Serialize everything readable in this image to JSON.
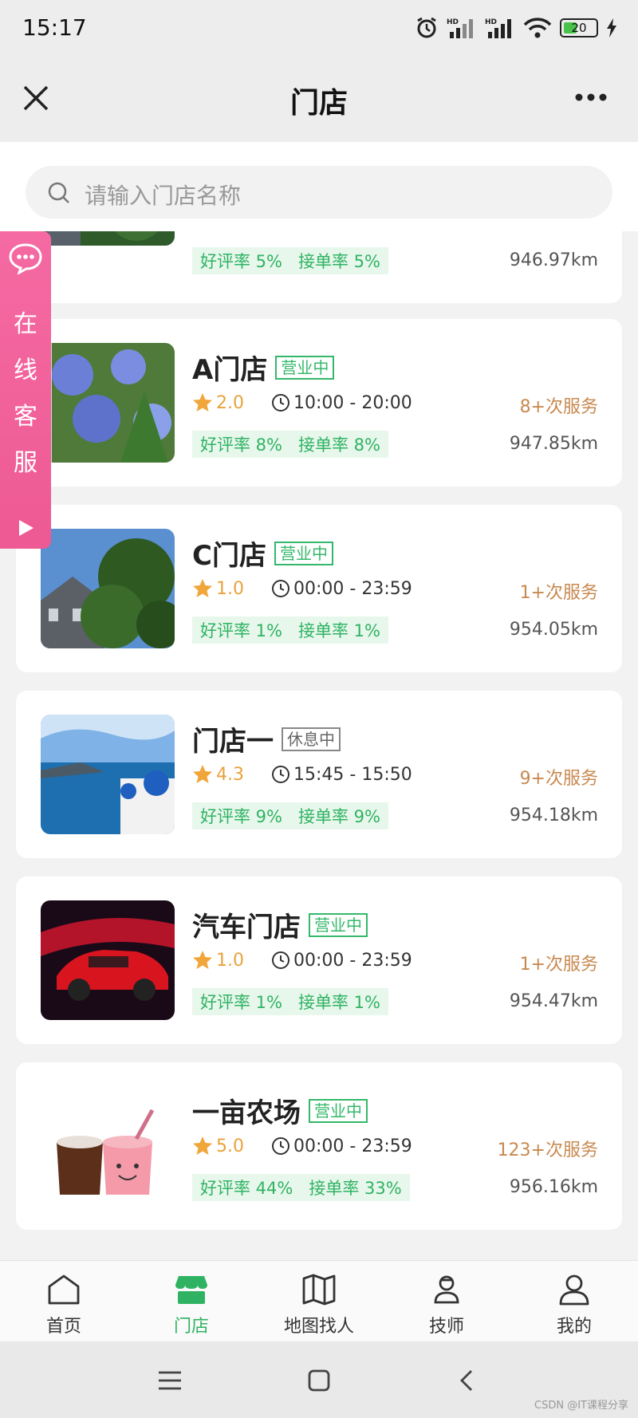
{
  "status_bar": {
    "time": "15:17",
    "battery": "20"
  },
  "header": {
    "title": "门店"
  },
  "search": {
    "placeholder": "请输入门店名称"
  },
  "float_service": {
    "chars": [
      "在",
      "线",
      "客",
      "服"
    ]
  },
  "stores": [
    {
      "name": "",
      "status": "",
      "rating": "",
      "hours": "",
      "service": "",
      "good_rate": "好评率 5%",
      "accept_rate": "接单率 5%",
      "distance": "946.97km"
    },
    {
      "name": "A门店",
      "status": "营业中",
      "rating": "2.0",
      "hours": "10:00 - 20:00",
      "service": "8+次服务",
      "good_rate": "好评率 8%",
      "accept_rate": "接单率 8%",
      "distance": "947.85km"
    },
    {
      "name": "C门店",
      "status": "营业中",
      "rating": "1.0",
      "hours": "00:00 - 23:59",
      "service": "1+次服务",
      "good_rate": "好评率 1%",
      "accept_rate": "接单率 1%",
      "distance": "954.05km"
    },
    {
      "name": "门店一",
      "status": "休息中",
      "rating": "4.3",
      "hours": "15:45 - 15:50",
      "service": "9+次服务",
      "good_rate": "好评率 9%",
      "accept_rate": "接单率 9%",
      "distance": "954.18km"
    },
    {
      "name": "汽车门店",
      "status": "营业中",
      "rating": "1.0",
      "hours": "00:00 - 23:59",
      "service": "1+次服务",
      "good_rate": "好评率 1%",
      "accept_rate": "接单率 1%",
      "distance": "954.47km"
    },
    {
      "name": "一亩农场",
      "status": "营业中",
      "rating": "5.0",
      "hours": "00:00 - 23:59",
      "service": "123+次服务",
      "good_rate": "好评率 44%",
      "accept_rate": "接单率 33%",
      "distance": "956.16km"
    }
  ],
  "tabs": [
    {
      "label": "首页",
      "icon": "home-icon"
    },
    {
      "label": "门店",
      "icon": "store-icon",
      "active": true
    },
    {
      "label": "地图找人",
      "icon": "map-icon"
    },
    {
      "label": "技师",
      "icon": "technician-icon"
    },
    {
      "label": "我的",
      "icon": "profile-icon"
    }
  ],
  "watermark": "CSDN @IT课程分享",
  "colors": {
    "accent": "#2fb363",
    "service": "#c8894f",
    "rating": "#e8a33c",
    "float": "#f56aa3"
  }
}
